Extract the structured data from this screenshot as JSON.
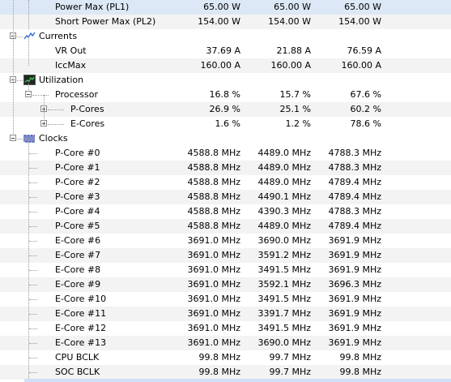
{
  "power": [
    {
      "label": "Power Max (PL1)",
      "v1": "65.00 W",
      "v2": "65.00 W",
      "v3": "65.00 W"
    },
    {
      "label": "Short Power Max (PL2)",
      "v1": "154.00 W",
      "v2": "154.00 W",
      "v3": "154.00 W"
    }
  ],
  "currents": {
    "title": "Currents",
    "icon": "current-wave-icon",
    "rows": [
      {
        "label": "VR Out",
        "v1": "37.69 A",
        "v2": "21.88 A",
        "v3": "76.59 A"
      },
      {
        "label": "IccMax",
        "v1": "160.00 A",
        "v2": "160.00 A",
        "v3": "160.00 A"
      }
    ]
  },
  "utilization": {
    "title": "Utilization",
    "icon": "utilization-monitor-icon",
    "processor": {
      "label": "Processor",
      "v1": "16.8 %",
      "v2": "15.7 %",
      "v3": "67.6 %"
    },
    "children": [
      {
        "label": "P-Cores",
        "v1": "26.9 %",
        "v2": "25.1 %",
        "v3": "60.2 %"
      },
      {
        "label": "E-Cores",
        "v1": "1.6 %",
        "v2": "1.2 %",
        "v3": "78.6 %"
      }
    ]
  },
  "clocks": {
    "title": "Clocks",
    "icon": "clock-waveform-icon",
    "rows": [
      {
        "label": "P-Core #0",
        "v1": "4588.8 MHz",
        "v2": "4489.0 MHz",
        "v3": "4788.3 MHz"
      },
      {
        "label": "P-Core #1",
        "v1": "4588.8 MHz",
        "v2": "4489.0 MHz",
        "v3": "4788.3 MHz"
      },
      {
        "label": "P-Core #2",
        "v1": "4588.8 MHz",
        "v2": "4489.0 MHz",
        "v3": "4789.4 MHz"
      },
      {
        "label": "P-Core #3",
        "v1": "4588.8 MHz",
        "v2": "4490.1 MHz",
        "v3": "4789.4 MHz"
      },
      {
        "label": "P-Core #4",
        "v1": "4588.8 MHz",
        "v2": "4390.3 MHz",
        "v3": "4788.3 MHz"
      },
      {
        "label": "P-Core #5",
        "v1": "4588.8 MHz",
        "v2": "4489.0 MHz",
        "v3": "4789.4 MHz"
      },
      {
        "label": "E-Core #6",
        "v1": "3691.0 MHz",
        "v2": "3690.0 MHz",
        "v3": "3691.9 MHz"
      },
      {
        "label": "E-Core #7",
        "v1": "3691.0 MHz",
        "v2": "3591.2 MHz",
        "v3": "3691.9 MHz"
      },
      {
        "label": "E-Core #8",
        "v1": "3691.0 MHz",
        "v2": "3491.5 MHz",
        "v3": "3691.9 MHz"
      },
      {
        "label": "E-Core #9",
        "v1": "3691.0 MHz",
        "v2": "3592.1 MHz",
        "v3": "3696.3 MHz"
      },
      {
        "label": "E-Core #10",
        "v1": "3691.0 MHz",
        "v2": "3491.5 MHz",
        "v3": "3691.9 MHz"
      },
      {
        "label": "E-Core #11",
        "v1": "3691.0 MHz",
        "v2": "3391.7 MHz",
        "v3": "3691.9 MHz"
      },
      {
        "label": "E-Core #12",
        "v1": "3691.0 MHz",
        "v2": "3491.5 MHz",
        "v3": "3691.9 MHz"
      },
      {
        "label": "E-Core #13",
        "v1": "3691.0 MHz",
        "v2": "3690.0 MHz",
        "v3": "3691.9 MHz"
      },
      {
        "label": "CPU BCLK",
        "v1": "99.8 MHz",
        "v2": "99.7 MHz",
        "v3": "99.8 MHz"
      },
      {
        "label": "SOC BCLK",
        "v1": "99.8 MHz",
        "v2": "99.7 MHz",
        "v3": "99.8 MHz"
      }
    ]
  },
  "colors": {
    "accent": "#2b6cd8",
    "selection": "#cfe0f6",
    "row_alt": "#f3f3f3"
  }
}
